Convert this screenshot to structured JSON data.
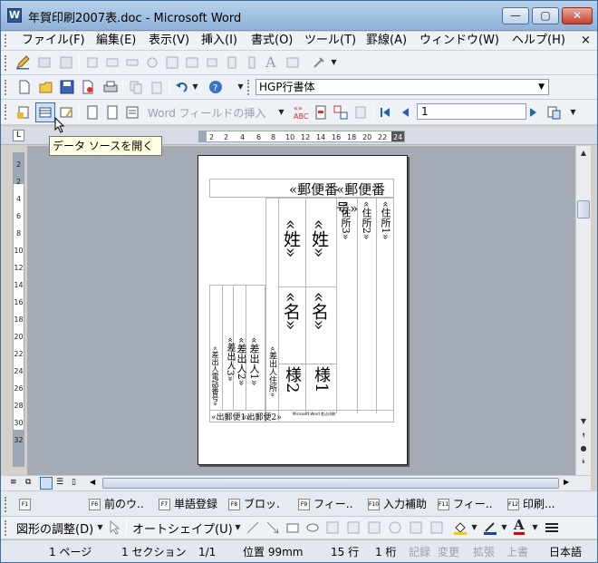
{
  "window": {
    "title": "年賀印刷2007表.doc - Microsoft Word",
    "icon": "word-doc-icon",
    "controls": {
      "minimize": "—",
      "restore": "▢",
      "close": "✕"
    }
  },
  "menubar": {
    "items": [
      "ファイル(F)",
      "編集(E)",
      "表示(V)",
      "挿入(I)",
      "書式(O)",
      "ツール(T)",
      "罫線(A)",
      "ウィンドウ(W)",
      "ヘルプ(H)"
    ],
    "close_doc": "×"
  },
  "formatting": {
    "font": "HGP行書体",
    "dropdown_icon": "▼"
  },
  "mailmerge_toolbar": {
    "insert_word_field": "Word フィールドの挿入",
    "record_number": "1"
  },
  "tooltip": {
    "text": "データ ソースを開く"
  },
  "ruler": {
    "ticks": [
      "2",
      "2",
      "4",
      "6",
      "8",
      "10",
      "12",
      "14",
      "16",
      "18",
      "20",
      "22",
      "24"
    ],
    "left_corner": "L",
    "vertical": [
      "2",
      "2",
      "4",
      "6",
      "8",
      "10",
      "12",
      "14",
      "16",
      "18",
      "20",
      "22",
      "24",
      "26",
      "28",
      "30",
      "32"
    ]
  },
  "document": {
    "postal_fields": [
      "«郵便番",
      "«郵便番号»"
    ],
    "address_fields": [
      "«住所3»",
      "«住所2»",
      "«住所1»"
    ],
    "recipient_surname": [
      "«姓»",
      "«姓»"
    ],
    "recipient_name": [
      "«名»",
      "«名»"
    ],
    "honorific": [
      "様2",
      "様1"
    ],
    "sender_fields": [
      "«差出人電話番号»",
      "«差出人3»",
      "«差出人2»",
      "«差出人1»",
      "«差出人住所»"
    ],
    "sender_postal": [
      "«出郵便1»",
      "«出郵便2»"
    ],
    "footer_note": "Microsoft Word 差込印刷"
  },
  "function_keys": [
    {
      "key": "F1",
      "label": ""
    },
    {
      "key": "F6",
      "label": "前のウ.."
    },
    {
      "key": "F7",
      "label": "単語登録"
    },
    {
      "key": "F8",
      "label": "ブロッ."
    },
    {
      "key": "F9",
      "label": "フィー.."
    },
    {
      "key": "F10",
      "label": "入力補助"
    },
    {
      "key": "F11",
      "label": "フィー.."
    },
    {
      "key": "F12",
      "label": "印刷..."
    }
  ],
  "drawing_toolbar": {
    "adjust": "図形の調整(D)",
    "autoshape": "オートシェイプ(U)"
  },
  "statusbar": {
    "page": "1 ページ",
    "section": "1 セクション",
    "page_of": "1/1",
    "position": "位置 99mm",
    "line": "15 行",
    "column": "1 桁",
    "rec": "記録",
    "trk": "変更",
    "ext": "拡張",
    "ovr": "上書",
    "language": "日本語"
  },
  "colors": {
    "accent": "#2b5797",
    "workspace": "#a4abb5",
    "tooltip_bg": "#ffffe1"
  }
}
